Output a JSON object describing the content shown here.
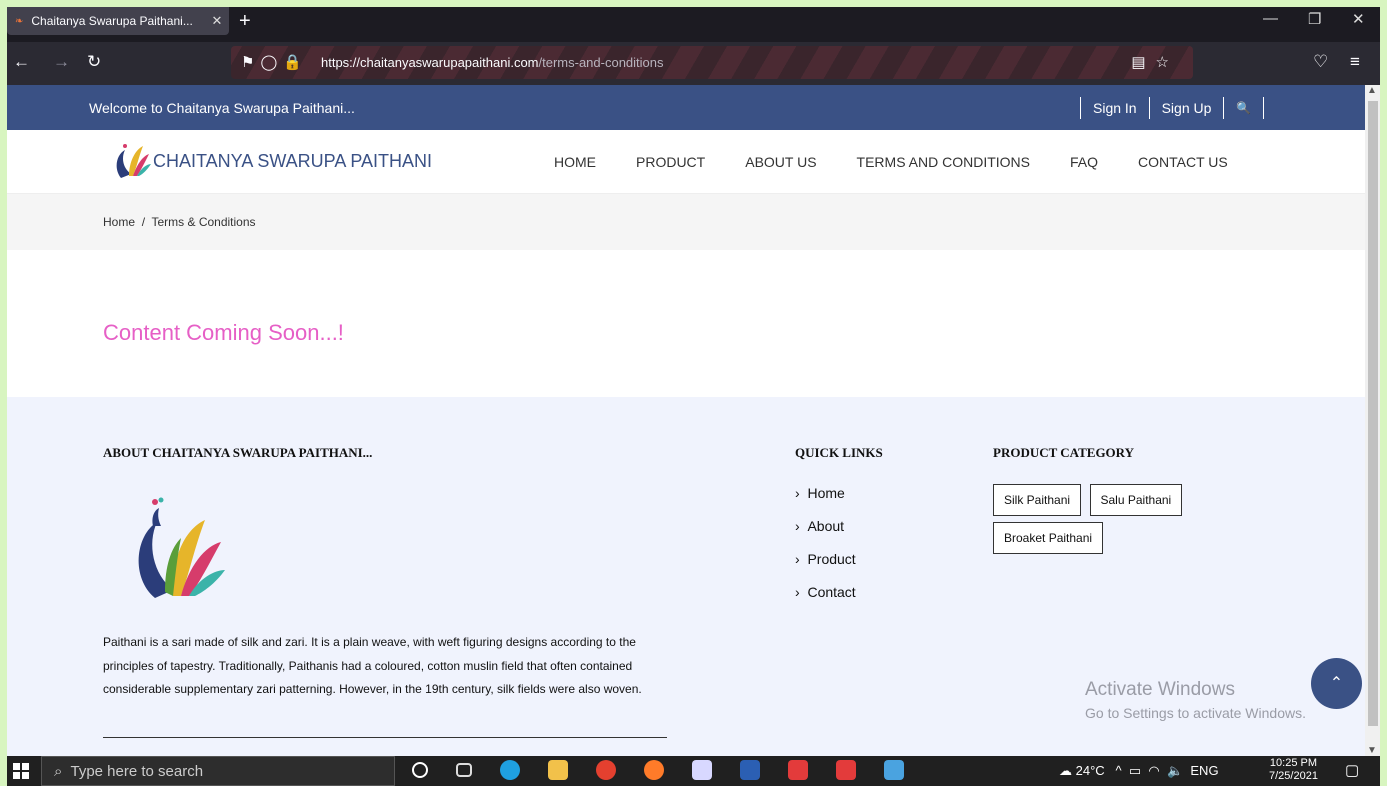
{
  "browser": {
    "tab_title": "Chaitanya Swarupa Paithani...",
    "url_domain": "https://chaitanyaswarupapaithani.com",
    "url_path": "/terms-and-conditions"
  },
  "topbar": {
    "welcome": "Welcome to Chaitanya Swarupa Paithani...",
    "sign_in": "Sign In",
    "sign_up": "Sign Up"
  },
  "header": {
    "brand": "CHAITANYA SWARUPA PAITHANI",
    "menu": [
      "HOME",
      "PRODUCT",
      "ABOUT US",
      "TERMS AND CONDITIONS",
      "FAQ",
      "CONTACT US"
    ]
  },
  "breadcrumb": {
    "home": "Home",
    "sep": "/",
    "current": "Terms & Conditions"
  },
  "main": {
    "message": "Content Coming Soon...!"
  },
  "footer": {
    "about_heading": "ABOUT CHAITANYA SWARUPA PAITHANI...",
    "about_text": "Paithani is a sari made of silk and zari. It is a plain weave, with weft figuring designs according to the principles of tapestry. Traditionally, Paithanis had a coloured, cotton muslin field that often contained considerable supplementary zari patterning. However, in the 19th century, silk fields were also woven.",
    "quick_links_heading": "QUICK LINKS",
    "quick_links": [
      "Home",
      "About",
      "Product",
      "Contact"
    ],
    "category_heading": "PRODUCT CATEGORY",
    "categories": [
      "Silk Paithani",
      "Salu Paithani",
      "Broaket Paithani"
    ]
  },
  "overlay": {
    "activate_title": "Activate Windows",
    "activate_sub": "Go to Settings to activate Windows."
  },
  "taskbar": {
    "search_placeholder": "Type here to search",
    "weather": "24°C",
    "lang": "ENG",
    "time": "10:25 PM",
    "date": "7/25/2021"
  },
  "colors": {
    "brand": "#3a5185",
    "accent": "#e65fc6",
    "footer_bg": "#f0f3fd"
  }
}
